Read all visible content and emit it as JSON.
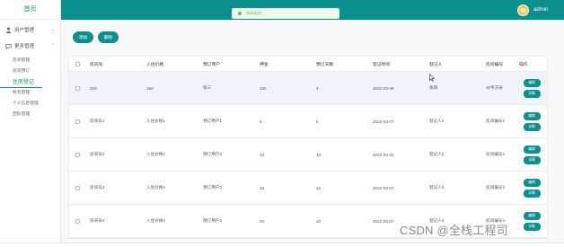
{
  "sidebar": {
    "brand": "首页",
    "groups": [
      {
        "label": "用户管理",
        "icon": "user-icon"
      },
      {
        "label": "更多管理",
        "icon": "chat-icon"
      }
    ],
    "items": [
      "房间管理",
      "房间预订",
      "住房登记",
      "财务管理",
      "个人信息管理",
      "团队管理"
    ],
    "active_index": 2
  },
  "header": {
    "toast": "修改成功！",
    "username": "admin",
    "bg": "#0b8f8f"
  },
  "toolbar": {
    "add_label": "添加",
    "delete_label": "删除"
  },
  "table": {
    "columns": [
      "房间号",
      "入住价格",
      "预订用户",
      "押金",
      "预订天数",
      "登记时间",
      "登记人",
      "房间编号",
      "操作"
    ],
    "rows": [
      [
        "302",
        "150",
        "张三",
        "100",
        "4",
        "2022-03-08",
        "张四",
        "30平方米"
      ],
      [
        "房间号1",
        "入住价格1",
        "预订用户1",
        "5",
        "5",
        "2022-03-07",
        "登记人1",
        "房间编号1"
      ],
      [
        "房间号2",
        "入住价格2",
        "预订用户2",
        "10",
        "10",
        "2022-03-32",
        "登记人2",
        "房间编号2"
      ],
      [
        "房间号3",
        "入住价格3",
        "预订用户3",
        "15",
        "15",
        "2022-03-07",
        "登记人3",
        "房间编号3"
      ],
      [
        "房间号4",
        "入住价格4",
        "预订用户4",
        "20",
        "20",
        "2022-03-07",
        "登记人4",
        "房间编号4"
      ]
    ],
    "edit_label": "编辑",
    "detail_label": "详情"
  },
  "watermark": "CSDN @全栈工程司",
  "colors": {
    "accent": "#0b8f8f",
    "success": "#67c23a"
  }
}
